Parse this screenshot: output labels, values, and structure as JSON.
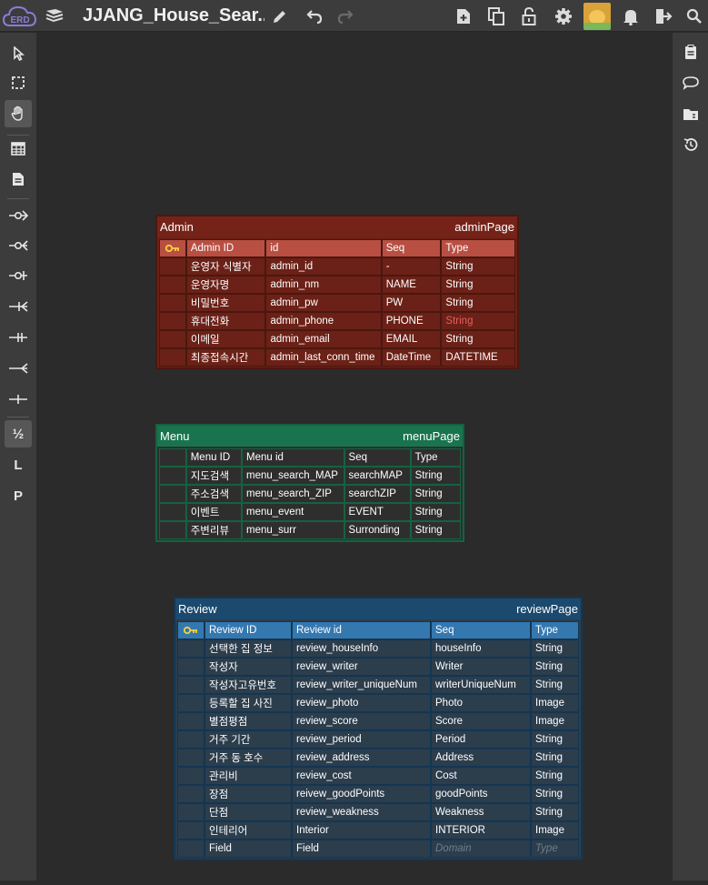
{
  "app": {
    "logo_text": "ERD",
    "title": "JJANG_House_Sear...",
    "colors": {
      "topbar": "#3c3c3c",
      "canvas": "#2b2b2b"
    }
  },
  "toolbar": {
    "icons": [
      "pencil-icon",
      "undo-icon",
      "redo-icon",
      "new-file-icon",
      "copy-icon",
      "lock-icon",
      "gear-icon",
      "avatar",
      "bell-icon",
      "logout-icon",
      "search-icon"
    ]
  },
  "left_toolbar": {
    "items": [
      "pointer-icon",
      "select-box-icon",
      "hand-icon",
      "table-icon",
      "memo-icon",
      "rel-zero-one-icon",
      "rel-zero-many-icon",
      "rel-one-only-icon",
      "rel-one-many-icon",
      "rel-one-one-icon",
      "rel-many-icon",
      "rel-line-icon",
      "column-type-icon",
      "logical-icon",
      "physical-icon"
    ],
    "labels": {
      "fraction": "½",
      "logical": "L",
      "physical": "P"
    }
  },
  "right_toolbar": {
    "items": [
      "clipboard-icon",
      "comment-icon",
      "folder-icon",
      "history-icon"
    ]
  },
  "tables": {
    "admin": {
      "name": "Admin",
      "comment": "adminPage",
      "colors": {
        "header": "#752319",
        "body": "#6b2117",
        "border": "#4a1710",
        "col_header": "#b84f42",
        "key": "#f5d13b"
      },
      "columns": [
        "Admin ID",
        "id",
        "Seq",
        "Type"
      ],
      "rows": [
        [
          "운영자 식별자",
          "admin_id",
          "-",
          "String"
        ],
        [
          "운영자명",
          "admin_nm",
          "NAME",
          "String"
        ],
        [
          "비밀번호",
          "admin_pw",
          "PW",
          "String"
        ],
        [
          "휴대전화",
          "admin_phone",
          "PHONE",
          "String"
        ],
        [
          "이메일",
          "admin_email",
          "EMAIL",
          "String"
        ],
        [
          "최종접속시간",
          "admin_last_conn_time",
          "DateTime",
          "DATETIME"
        ]
      ]
    },
    "menu": {
      "name": "Menu",
      "comment": "menuPage",
      "colors": {
        "header": "#19744d",
        "body": "#2e2e2e",
        "border": "#156240"
      },
      "columns": [
        "Menu ID",
        "Menu id",
        "Seq",
        "Type"
      ],
      "rows": [
        [
          "지도검색",
          "menu_search_MAP",
          "searchMAP",
          "String"
        ],
        [
          "주소검색",
          "menu_search_ZIP",
          "searchZIP",
          "String"
        ],
        [
          "이벤트",
          "menu_event",
          "EVENT",
          "String"
        ],
        [
          "주변리뷰",
          "menu_surr",
          "Surronding",
          "String"
        ]
      ]
    },
    "review": {
      "name": "Review",
      "comment": "reviewPage",
      "colors": {
        "header": "#1c4a6e",
        "body": "#2c3d4c",
        "border": "#133652",
        "col_header": "#3478b0",
        "key": "#f5d13b"
      },
      "columns": [
        "Review ID",
        "Review id",
        "Seq",
        "Type"
      ],
      "rows": [
        [
          "선택한 집 정보",
          "review_houseInfo",
          "houseInfo",
          "String"
        ],
        [
          "작성자",
          "review_writer",
          "Writer",
          "String"
        ],
        [
          "작성자고유번호",
          "review_writer_uniqueNum",
          "writerUniqueNum",
          "String"
        ],
        [
          "등록할 집 사진",
          "review_photo",
          "Photo",
          "Image"
        ],
        [
          "별점평점",
          "review_score",
          "Score",
          "Image"
        ],
        [
          "거주 기간",
          "review_period",
          "Period",
          "String"
        ],
        [
          "거주 동 호수",
          "review_address",
          "Address",
          "String"
        ],
        [
          "관리비",
          "review_cost",
          "Cost",
          "String"
        ],
        [
          "장점",
          "reivew_goodPoints",
          "goodPoints",
          "String"
        ],
        [
          "단점",
          "review_weakness",
          "Weakness",
          "String"
        ],
        [
          "인테리어",
          "Interior",
          "INTERIOR",
          "Image"
        ],
        [
          "Field",
          "Field",
          "Domain",
          "Type"
        ]
      ]
    }
  }
}
